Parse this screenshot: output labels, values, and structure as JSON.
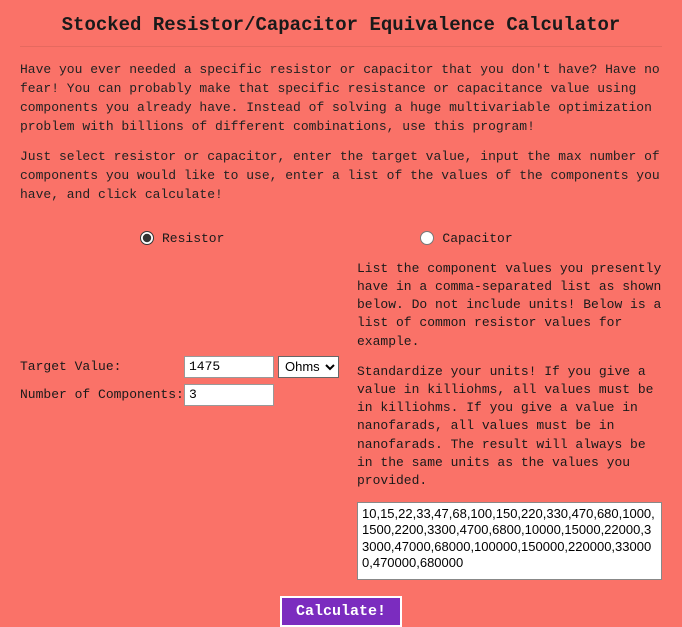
{
  "title": "Stocked Resistor/Capacitor Equivalence Calculator",
  "intro1": "Have you ever needed a specific resistor or capacitor that you don't have? Have no fear! You can probably make that specific resistance or capacitance value using components you already have. Instead of solving a huge multivariable optimization problem with billions of different combinations, use this program!",
  "intro2": "Just select resistor or capacitor, enter the target value, input the max number of components you would like to use, enter a list of the values of the components you have, and click calculate!",
  "radio": {
    "resistor_label": "Resistor",
    "capacitor_label": "Capacitor",
    "selected": "resistor"
  },
  "left": {
    "target_label": "Target Value:",
    "target_value": "1475",
    "unit_selected": "Ohms",
    "unit_options": [
      "Ohms"
    ],
    "num_label": "Number of Components:",
    "num_value": "3"
  },
  "right": {
    "para1": "List the component values you presently have in a comma-separated list as shown below. Do not include units! Below is a list of common resistor values for example.",
    "para2": "Standardize your units! If you give a value in killiohms, all values must be in killiohms. If you give a value in nanofarads, all values must be in nanofarads. The result will always be in the same units as the values you provided.",
    "values": "10,15,22,33,47,68,100,150,220,330,470,680,1000,1500,2200,3300,4700,6800,10000,15000,22000,33000,47000,68000,100000,150000,220000,330000,470000,680000"
  },
  "button_label": "Calculate!"
}
